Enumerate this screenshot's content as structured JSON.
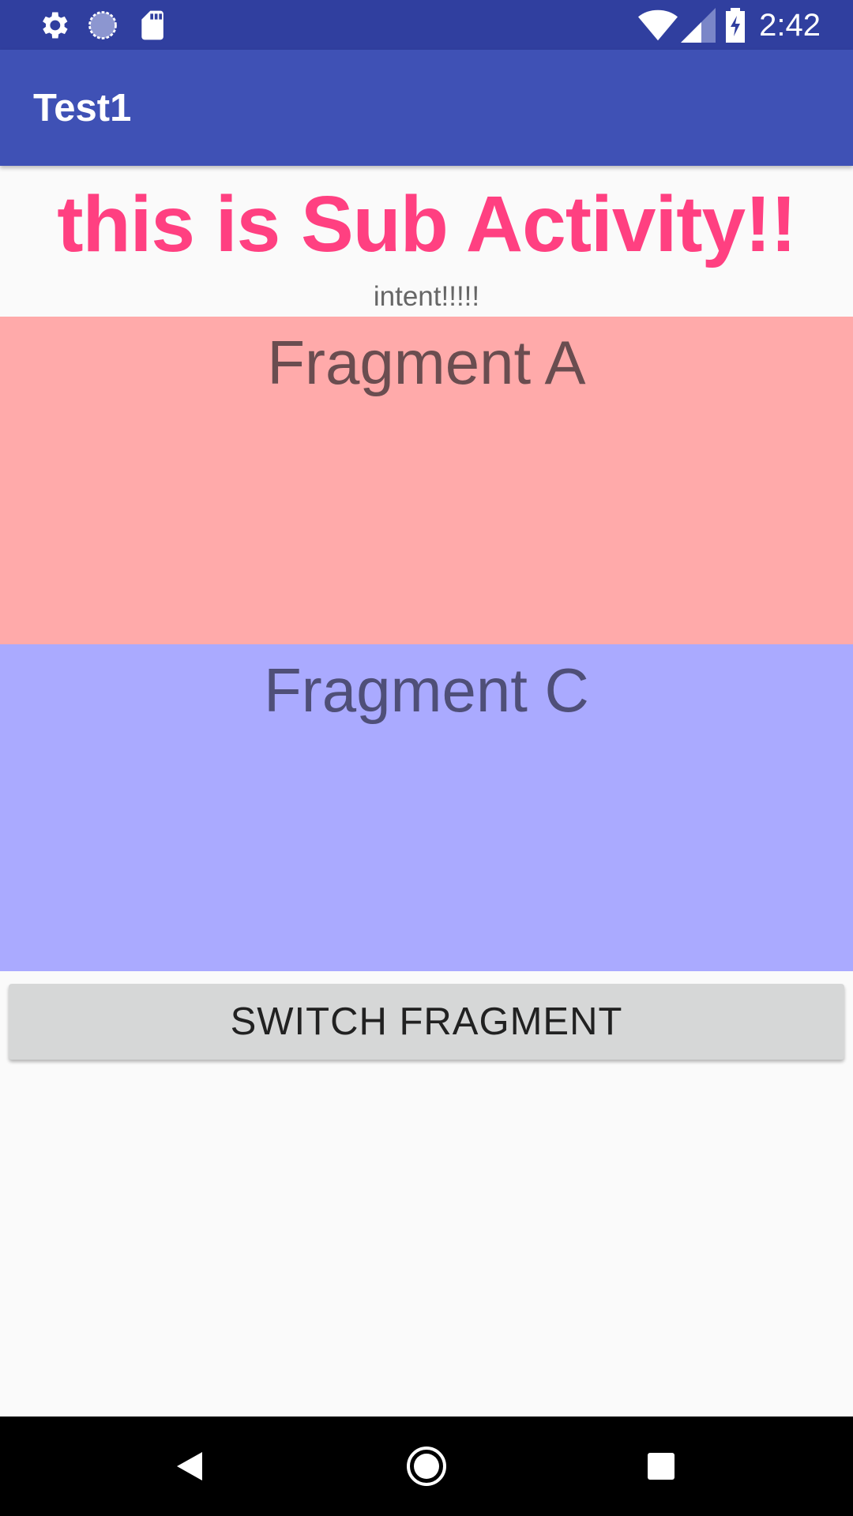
{
  "status_bar": {
    "time": "2:42",
    "icons": [
      "settings-icon",
      "sync-icon",
      "sd-card-icon",
      "wifi-icon",
      "signal-icon",
      "battery-charging-icon"
    ],
    "color": "#303f9f"
  },
  "app_bar": {
    "title": "Test1",
    "color": "#3f51b5"
  },
  "main": {
    "headline": "this is Sub Activity!!",
    "headline_color": "#ff4081",
    "subtext": "intent!!!!!",
    "fragments": [
      {
        "label": "Fragment A",
        "color": "#ffaaaa"
      },
      {
        "label": "Fragment C",
        "color": "#aaaaff"
      }
    ],
    "switch_button_label": "SWITCH FRAGMENT"
  },
  "nav_bar": {
    "buttons": [
      "back-icon",
      "home-icon",
      "recents-icon"
    ]
  }
}
